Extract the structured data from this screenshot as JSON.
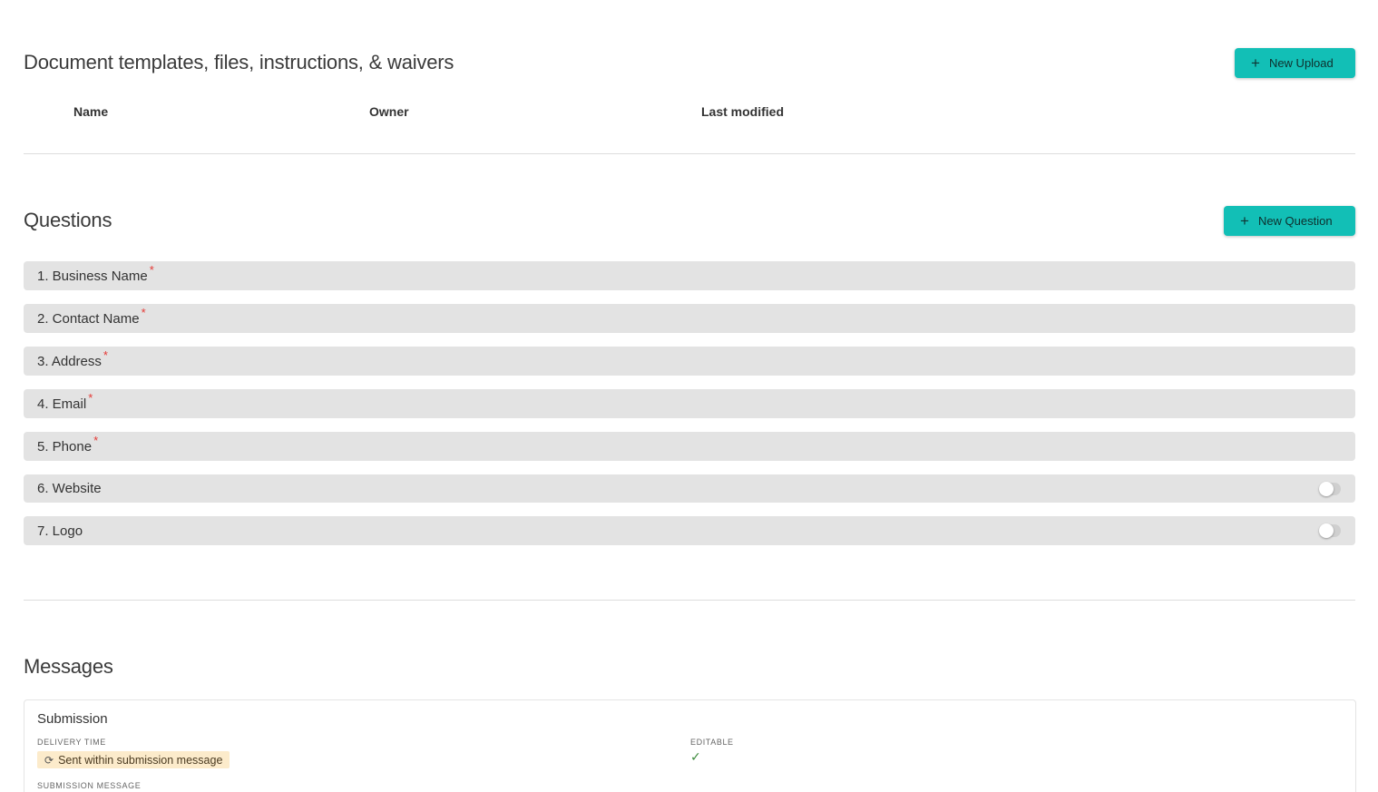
{
  "documents": {
    "title": "Document templates, files, instructions, & waivers",
    "new_upload_label": "New Upload",
    "columns": [
      "Name",
      "Owner",
      "Last modified"
    ]
  },
  "questions": {
    "title": "Questions",
    "new_question_label": "New Question",
    "items": [
      {
        "label": "1. Business Name",
        "required": "*"
      },
      {
        "label": "2. Contact Name",
        "required": "*"
      },
      {
        "label": "3. Address",
        "required": "*"
      },
      {
        "label": "4. Email",
        "required": "*"
      },
      {
        "label": "5. Phone",
        "required": "*"
      },
      {
        "label": "6. Website",
        "toggle": false
      },
      {
        "label": "7. Logo",
        "toggle": false
      }
    ]
  },
  "messages": {
    "title": "Messages",
    "card": {
      "title": "Submission",
      "delivery_time_label": "DELIVERY TIME",
      "delivery_badge": "Sent within submission message",
      "editable_label": "EDITABLE",
      "editable_icon": "check-icon",
      "submission_message_label": "SUBMISSION MESSAGE"
    }
  },
  "colors": {
    "accent": "#12bfb6",
    "row_bg": "#e3e3e3",
    "required": "#e53935",
    "badge_bg": "#fcebcb",
    "check": "#3c8a3c"
  }
}
